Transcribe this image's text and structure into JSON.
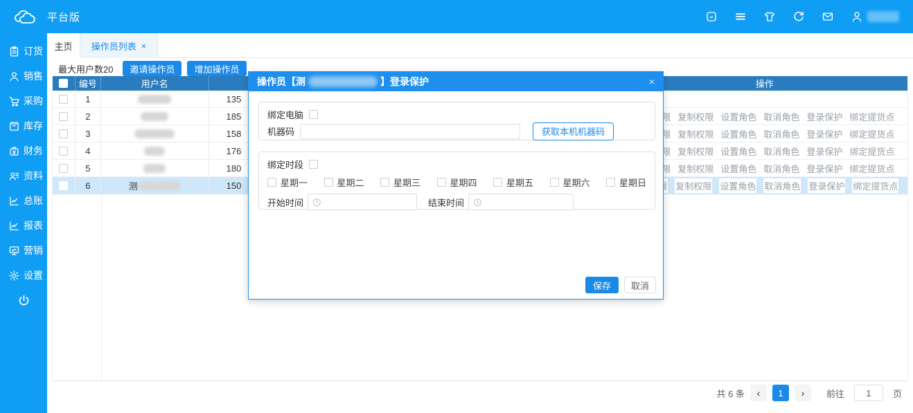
{
  "topbar": {
    "title": "平台版"
  },
  "sidebar": {
    "items": [
      {
        "label": "订货"
      },
      {
        "label": "销售"
      },
      {
        "label": "采购"
      },
      {
        "label": "库存"
      },
      {
        "label": "财务"
      },
      {
        "label": "资料"
      },
      {
        "label": "总账"
      },
      {
        "label": "报表"
      },
      {
        "label": "营销"
      },
      {
        "label": "设置"
      }
    ]
  },
  "tabs": {
    "home": "主页",
    "current": "操作员列表",
    "close": "×"
  },
  "toolbar": {
    "max_users": "最大用户数20",
    "invite": "邀请操作员",
    "add": "增加操作员"
  },
  "table": {
    "headers": {
      "no": "编号",
      "username": "用户名",
      "actions": "操作"
    },
    "action_labels": [
      "设置权限",
      "复制权限",
      "设置角色",
      "取消角色",
      "登录保护",
      "绑定提货点"
    ],
    "rows": [
      {
        "no": "1",
        "phone": "135"
      },
      {
        "no": "2",
        "phone": "185"
      },
      {
        "no": "3",
        "phone": "158"
      },
      {
        "no": "4",
        "phone": "176"
      },
      {
        "no": "5",
        "phone": "180"
      },
      {
        "no": "6",
        "name_prefix": "测",
        "phone": "150"
      }
    ]
  },
  "modal": {
    "title_prefix": "操作员【测",
    "title_suffix": "】登录保护",
    "close": "×",
    "bind_computer": "绑定电脑",
    "machine_code_label": "机器码",
    "get_code_button": "获取本机机器码",
    "bind_period": "绑定时段",
    "weekdays": [
      "星期一",
      "星期二",
      "星期三",
      "星期四",
      "星期五",
      "星期六",
      "星期日"
    ],
    "start_time_label": "开始时间",
    "end_time_label": "结束时间",
    "save": "保存",
    "cancel": "取消"
  },
  "pagination": {
    "total": "共 6 条",
    "prev": "‹",
    "page": "1",
    "next": "›",
    "goto_label": "前往",
    "goto_value": "1",
    "page_unit": "页"
  },
  "colors": {
    "brand_blue": "#109ef4",
    "primary_blue": "#1b89e8",
    "table_header_blue": "#2a7cbe",
    "row_highlight": "#cfe7fa"
  }
}
